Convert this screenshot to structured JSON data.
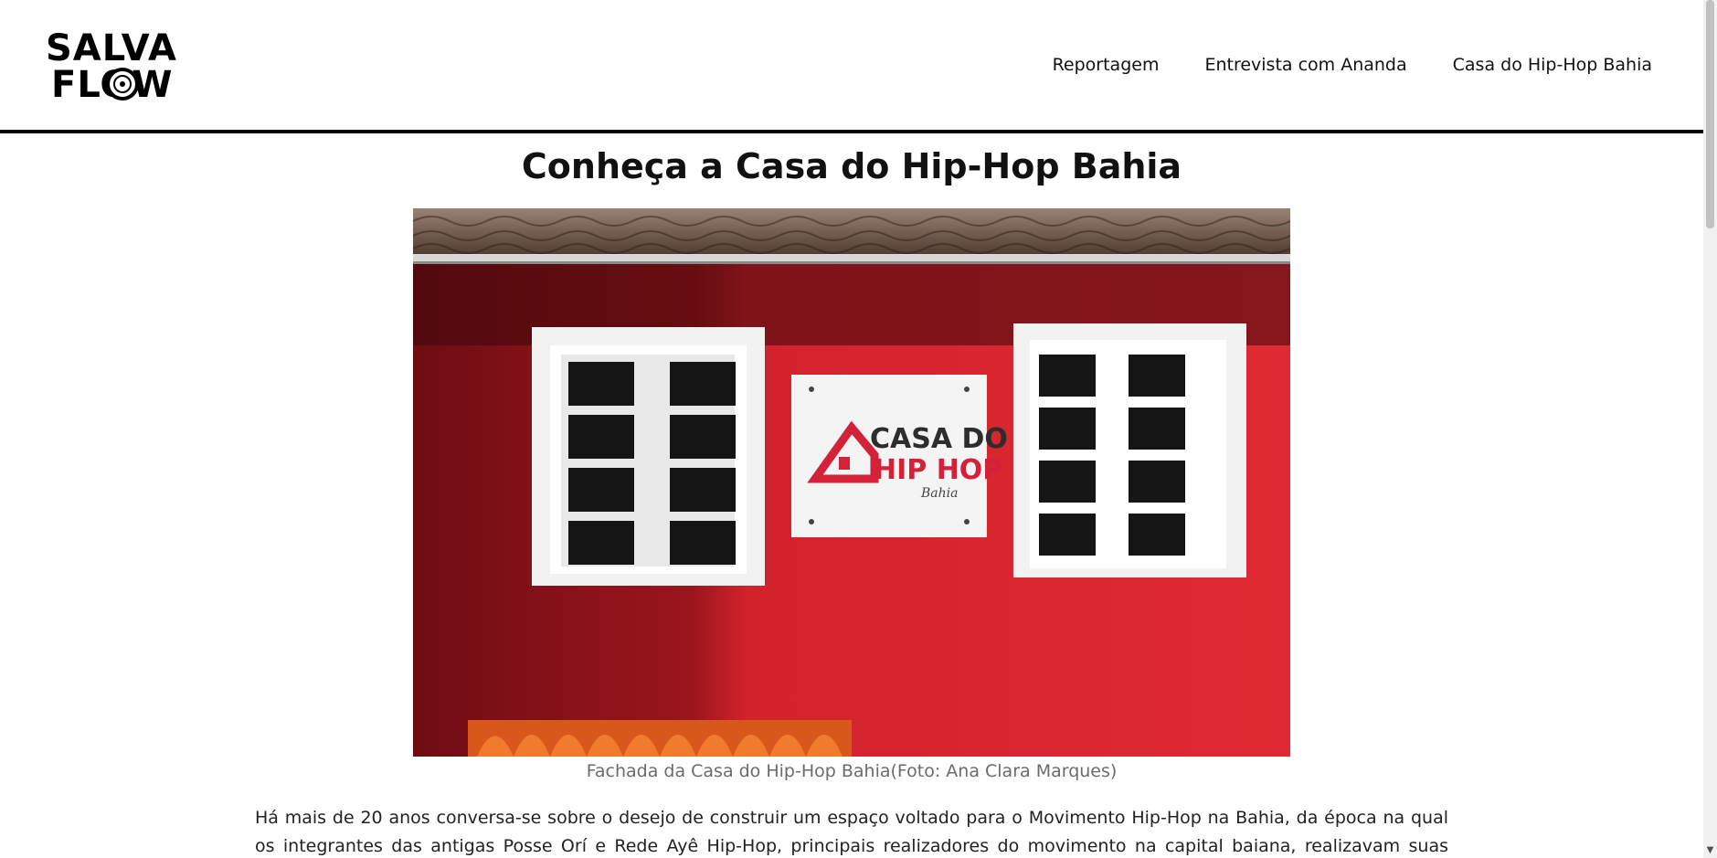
{
  "header": {
    "logo_line1": "SALVA",
    "logo_line2": "FLOW",
    "nav": [
      {
        "label": "Reportagem"
      },
      {
        "label": "Entrevista com Ananda"
      },
      {
        "label": "Casa do Hip-Hop Bahia"
      }
    ]
  },
  "article": {
    "title": "Conheça a Casa do Hip-Hop Bahia",
    "image_alt": "Fachada da Casa do Hip-Hop Bahia",
    "sign_line1": "CASA DO",
    "sign_line2": "HIP HOP",
    "sign_line3": "Bahia",
    "caption": "Fachada da Casa do Hip-Hop Bahia(Foto: Ana Clara Marques)",
    "paragraph": "Há mais de 20 anos conversa-se sobre o desejo de construir um espaço voltado para o Movimento Hip-Hop na Bahia, da época na qual os integrantes das antigas Posse Orí e Rede Ayê Hip-Hop, principais realizadores do movimento na capital baiana, realizavam suas reuniões em praça"
  },
  "colors": {
    "wall_red": "#c8202a",
    "header_rule": "#000000",
    "sign_red": "#d4213a"
  },
  "icons": {
    "scroll_down": "chevron-down-icon"
  }
}
